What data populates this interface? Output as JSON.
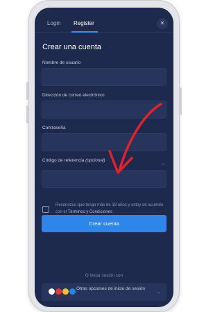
{
  "tabs": {
    "login": "Login",
    "register": "Register"
  },
  "close_glyph": "✕",
  "form": {
    "title": "Crear una cuenta",
    "username_label": "Nombre de usuario",
    "email_label": "Dirección de correo electrónico",
    "password_label": "Contraseña",
    "referral_label": "Código de referencia",
    "referral_optional": "(opcional)",
    "referral_chevron": "⌃",
    "terms_text_1": "Reconozco que tengo más de 18 años y estoy de acuerdo con el",
    "terms_link": "Términos y Condiciones",
    "submit_label": "Crear cuenta"
  },
  "alt_login": {
    "divider_text": "O inicia sesión con",
    "button_label": "Otras opciones de inicio de sesión",
    "chevron": "⌄",
    "logo_colors": [
      "#ffffff",
      "#e53935",
      "#fbc02d",
      "#1e88e5"
    ]
  },
  "colors": {
    "screen_bg": "#1e2a4d",
    "accent": "#2f86ea",
    "arrow": "#e0222b"
  },
  "icons": {
    "close": "close-icon",
    "chevron_up": "chevron-up-icon",
    "chevron_down": "chevron-down-icon",
    "checkbox": "checkbox-icon"
  }
}
